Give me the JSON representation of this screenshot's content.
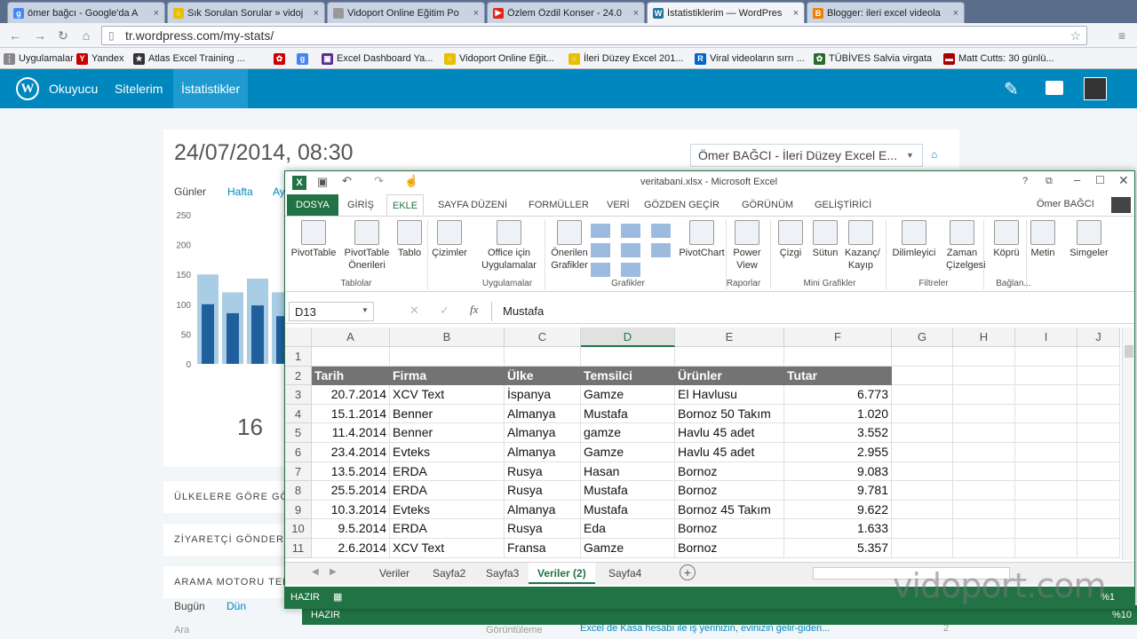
{
  "browser": {
    "tabs": [
      {
        "label": "ömer bağcı - Google'da A",
        "color": "#4285f4",
        "glyph": "g"
      },
      {
        "label": "Sık Sorulan Sorular » vidoj",
        "color": "#e8c000",
        "glyph": "○"
      },
      {
        "label": "Vidoport Online Eğitim Po",
        "color": "#999999",
        "glyph": ""
      },
      {
        "label": "Özlem Özdil Konser - 24.0",
        "color": "#e62117",
        "glyph": "▶"
      },
      {
        "label": "İstatistiklerim — WordPres",
        "color": "#21759b",
        "glyph": "W"
      },
      {
        "label": "Blogger: ileri excel videola",
        "color": "#f57d00",
        "glyph": "B"
      }
    ],
    "close_glyph": "×",
    "url": "tr.wordpress.com/my-stats/",
    "bookmarks": [
      {
        "label": "Uygulamalar",
        "color": "#888888",
        "glyph": "⋮"
      },
      {
        "label": "Yandex",
        "color": "#cc0000",
        "glyph": "Y"
      },
      {
        "label": "Atlas Excel Training ...",
        "color": "#333333",
        "glyph": "★"
      },
      {
        "label": "",
        "color": "#cc0000",
        "glyph": "✿"
      },
      {
        "label": "",
        "color": "#4285f4",
        "glyph": "g"
      },
      {
        "label": "Excel Dashboard Ya...",
        "color": "#5c2d91",
        "glyph": "▣"
      },
      {
        "label": "Vidoport Online Eğit...",
        "color": "#e8c000",
        "glyph": "○"
      },
      {
        "label": "İleri Düzey Excel 201...",
        "color": "#e8c000",
        "glyph": "○"
      },
      {
        "label": "Viral videoların sırrı ...",
        "color": "#0066cc",
        "glyph": "R"
      },
      {
        "label": "TÜBİVES Salvia virgata",
        "color": "#2a6a2a",
        "glyph": "✿"
      },
      {
        "label": "Matt Cutts: 30 günlü...",
        "color": "#aa0000",
        "glyph": "▬"
      }
    ]
  },
  "wp": {
    "nav": [
      "Okuyucu",
      "Sitelerim",
      "İstatistikler"
    ],
    "date_title": "24/07/2014, 08:30",
    "blog_select": "Ömer BAĞCI - İleri Düzey Excel E...",
    "period_tabs": [
      "Günler",
      "Hafta",
      "Ay"
    ],
    "y_ticks": [
      "250",
      "200",
      "150",
      "100",
      "50",
      "0"
    ],
    "big_number": "16",
    "sections": [
      "ÜLKELERE GÖRE GÖST",
      "ZİYARETÇİ GÖNDEREN",
      "ARAMA MOTORU TERİ"
    ],
    "search_tabs": [
      "Bugün",
      "Dün"
    ],
    "footer_left": "Ara",
    "footer_mid": "Görüntüleme",
    "footer_link": "Excel de Kasa hesabı ile iş yerinizin, evinizin gelir-gideri...",
    "footer_num": "2"
  },
  "chart_data": {
    "type": "bar",
    "title": "",
    "ylim": [
      0,
      250
    ],
    "series": [
      {
        "values": [
          150,
          120,
          143,
          120
        ]
      },
      {
        "values": [
          100,
          85,
          98,
          80
        ]
      }
    ]
  },
  "excel": {
    "title": "veritabani.xlsx - Microsoft Excel",
    "user": "Ömer BAĞCI",
    "ribbon_tabs": [
      "DOSYA",
      "GİRİŞ",
      "EKLE",
      "SAYFA DÜZENİ",
      "FORMÜLLER",
      "VERİ",
      "GÖZDEN GEÇİR",
      "GÖRÜNÜM",
      "GELİŞTİRİCİ"
    ],
    "ribbon_buttons": [
      {
        "label": "PivotTable",
        "sub": ""
      },
      {
        "label": "PivotTable",
        "sub": "Önerileri"
      },
      {
        "label": "Tablo",
        "sub": ""
      },
      {
        "label": "Çizimler",
        "sub": ""
      },
      {
        "label": "Office için",
        "sub": "Uygulamalar"
      },
      {
        "label": "Önerilen",
        "sub": "Grafikler"
      },
      {
        "label": "PivotChart",
        "sub": ""
      },
      {
        "label": "Power",
        "sub": "View"
      },
      {
        "label": "Çizgi",
        "sub": ""
      },
      {
        "label": "Sütun",
        "sub": ""
      },
      {
        "label": "Kazanç/",
        "sub": "Kayıp"
      },
      {
        "label": "Dilimleyici",
        "sub": ""
      },
      {
        "label": "Zaman",
        "sub": "Çizelgesi"
      },
      {
        "label": "Köprü",
        "sub": ""
      },
      {
        "label": "Metin",
        "sub": ""
      },
      {
        "label": "Simgeler",
        "sub": ""
      }
    ],
    "ribbon_groups": [
      "Tablolar",
      "Uygulamalar",
      "Grafikler",
      "Raporlar",
      "Mini Grafikler",
      "Filtreler",
      "Bağlan..."
    ],
    "name_box": "D13",
    "formula": "Mustafa",
    "columns": [
      "A",
      "B",
      "C",
      "D",
      "E",
      "F",
      "G",
      "H",
      "I",
      "J"
    ],
    "rows": [
      "1",
      "2",
      "3",
      "4",
      "5",
      "6",
      "7",
      "8",
      "9",
      "10",
      "11"
    ],
    "headers": [
      "Tarih",
      "Firma",
      "Ülke",
      "Temsilci",
      "Ürünler",
      "Tutar"
    ],
    "data": [
      [
        "20.7.2014",
        "XCV Text",
        "İspanya",
        "Gamze",
        "El Havlusu",
        "6.773"
      ],
      [
        "15.1.2014",
        "Benner",
        "Almanya",
        "Mustafa",
        "Bornoz 50 Takım",
        "1.020"
      ],
      [
        "11.4.2014",
        "Benner",
        "Almanya",
        "gamze",
        "Havlu 45 adet",
        "3.552"
      ],
      [
        "23.4.2014",
        "Evteks",
        "Almanya",
        "Gamze",
        "Havlu 45 adet",
        "2.955"
      ],
      [
        "13.5.2014",
        "ERDA",
        "Rusya",
        "Hasan",
        "Bornoz",
        "9.083"
      ],
      [
        "25.5.2014",
        "ERDA",
        "Rusya",
        "Mustafa",
        "Bornoz",
        "9.781"
      ],
      [
        "10.3.2014",
        "Evteks",
        "Almanya",
        "Mustafa",
        "Bornoz 45 Takım",
        "9.622"
      ],
      [
        "9.5.2014",
        "ERDA",
        "Rusya",
        "Eda",
        "Bornoz",
        "1.633"
      ],
      [
        "2.6.2014",
        "XCV Text",
        "Fransa",
        "Gamze",
        "Bornoz",
        "5.357"
      ]
    ],
    "sheet_tabs": [
      "Veriler",
      "Sayfa2",
      "Sayfa3",
      "Veriler (2)",
      "Sayfa4"
    ],
    "active_sheet": 3,
    "status": "HAZIR",
    "zoom_front": "%1",
    "zoom_back": "%10"
  },
  "watermark": "vidoport.com"
}
